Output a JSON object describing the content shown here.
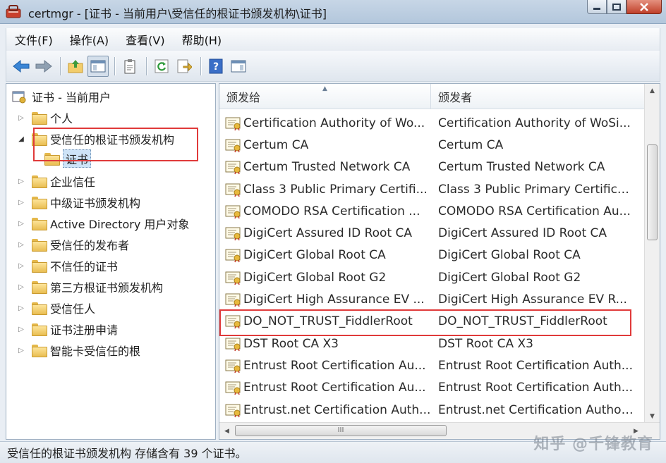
{
  "window": {
    "title": "certmgr - [证书 - 当前用户\\受信任的根证书颁发机构\\证书]"
  },
  "menu": [
    "文件(F)",
    "操作(A)",
    "查看(V)",
    "帮助(H)"
  ],
  "tree": {
    "root": "证书 - 当前用户",
    "items": [
      {
        "label": "个人",
        "expanded": false,
        "level": 1
      },
      {
        "label": "受信任的根证书颁发机构",
        "expanded": true,
        "level": 1
      },
      {
        "label": "证书",
        "expanded": false,
        "level": 2,
        "selected": true
      },
      {
        "label": "企业信任",
        "expanded": false,
        "level": 1
      },
      {
        "label": "中级证书颁发机构",
        "expanded": false,
        "level": 1
      },
      {
        "label": "Active Directory 用户对象",
        "expanded": false,
        "level": 1
      },
      {
        "label": "受信任的发布者",
        "expanded": false,
        "level": 1
      },
      {
        "label": "不信任的证书",
        "expanded": false,
        "level": 1
      },
      {
        "label": "第三方根证书颁发机构",
        "expanded": false,
        "level": 1
      },
      {
        "label": "受信任人",
        "expanded": false,
        "level": 1
      },
      {
        "label": "证书注册申请",
        "expanded": false,
        "level": 1
      },
      {
        "label": "智能卡受信任的根",
        "expanded": false,
        "level": 1
      }
    ]
  },
  "list": {
    "columns": [
      "颁发给",
      "颁发者"
    ],
    "rows": [
      [
        "Certification Authority of Wo...",
        "Certification Authority of WoSi..."
      ],
      [
        "Certum CA",
        "Certum CA"
      ],
      [
        "Certum Trusted Network CA",
        "Certum Trusted Network CA"
      ],
      [
        "Class 3 Public Primary Certifi...",
        "Class 3 Public Primary Certifica..."
      ],
      [
        "COMODO RSA Certification ...",
        "COMODO RSA Certification Au..."
      ],
      [
        "DigiCert Assured ID Root CA",
        "DigiCert Assured ID Root CA"
      ],
      [
        "DigiCert Global Root CA",
        "DigiCert Global Root CA"
      ],
      [
        "DigiCert Global Root G2",
        "DigiCert Global Root G2"
      ],
      [
        "DigiCert High Assurance EV ...",
        "DigiCert High Assurance EV R..."
      ],
      [
        "DO_NOT_TRUST_FiddlerRoot",
        "DO_NOT_TRUST_FiddlerRoot"
      ],
      [
        "DST Root CA X3",
        "DST Root CA X3"
      ],
      [
        "Entrust Root Certification Au...",
        "Entrust Root Certification Auth..."
      ],
      [
        "Entrust Root Certification Au...",
        "Entrust Root Certification Auth..."
      ],
      [
        "Entrust.net Certification Auth...",
        "Entrust.net Certification Author..."
      ]
    ]
  },
  "scrollbar": {
    "hthumb_grip": "III"
  },
  "status": "受信任的根证书颁发机构 存储含有 39 个证书。",
  "watermark": "知乎 @千锋教育",
  "colors": {
    "highlight": "#e03a3a",
    "selection": "#cde3f7"
  }
}
